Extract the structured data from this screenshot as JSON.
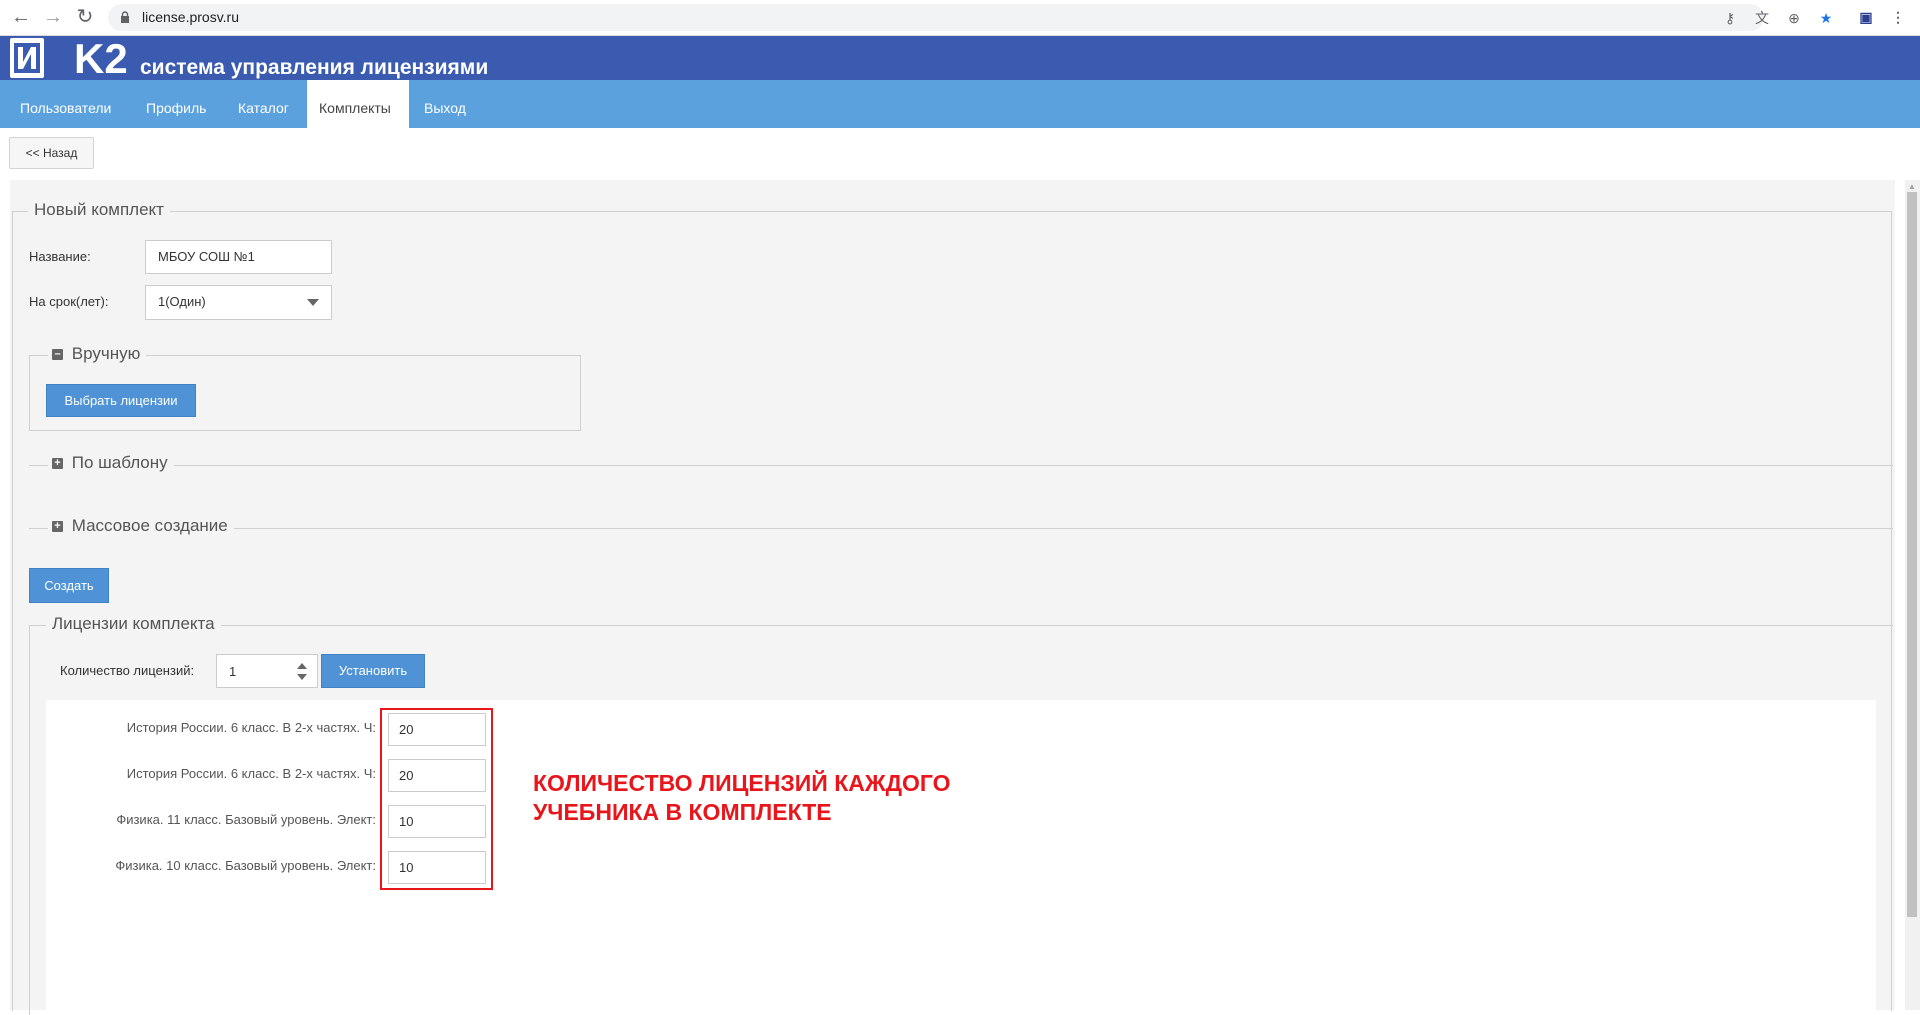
{
  "browser": {
    "url": "license.prosv.ru",
    "back_icon": "←",
    "forward_icon": "→",
    "reload_icon": "↻"
  },
  "header": {
    "brand": "K2",
    "subtitle": "система управления лицензиями"
  },
  "menu": {
    "items": [
      {
        "label": "Пользователи"
      },
      {
        "label": "Профиль"
      },
      {
        "label": "Каталог"
      },
      {
        "label": "Комплекты",
        "active": true
      },
      {
        "label": "Выход"
      }
    ]
  },
  "back_button": "<< Назад",
  "form": {
    "legend": "Новый комплект",
    "name_label": "Название:",
    "name_value": "МБОУ СОШ №1",
    "term_label": "На срок(лет):",
    "term_value": "1(Один)",
    "manual": {
      "legend": "Вручную",
      "toggle": "–",
      "button": "Выбрать лицензии"
    },
    "template": {
      "legend": "По шаблону",
      "toggle": "+"
    },
    "mass": {
      "legend": "Массовое создание",
      "toggle": "+"
    },
    "create_button": "Создать"
  },
  "licenses": {
    "legend": "Лицензии комплекта",
    "qty_label": "Количество лицензий:",
    "qty_value": "1",
    "set_button": "Установить",
    "rows": [
      {
        "label": "История России. 6 класс. В 2-х частях. Ч:",
        "value": "20"
      },
      {
        "label": "История России. 6 класс. В 2-х частях. Ч:",
        "value": "20"
      },
      {
        "label": "Физика. 11 класс. Базовый уровень. Элект:",
        "value": "10"
      },
      {
        "label": "Физика. 10 класс. Базовый уровень. Элект:",
        "value": "10"
      }
    ]
  },
  "annotation": "КОЛИЧЕСТВО ЛИЦЕНЗИЙ КАЖДОГО УЧЕБНИКА В КОМПЛЕКТЕ",
  "colors": {
    "header_bg": "#3a5bb0",
    "menu_bg": "#5ba1de",
    "button_blue": "#4f93d6",
    "annotation_red": "#e8151b"
  }
}
